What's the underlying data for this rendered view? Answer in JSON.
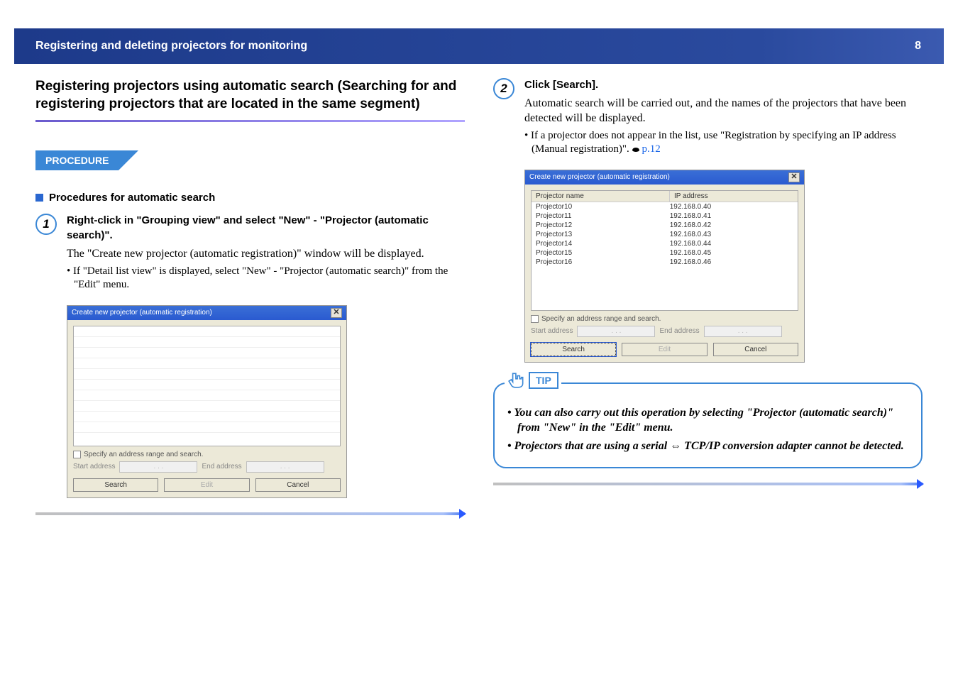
{
  "header": {
    "title": "Registering and deleting projectors for monitoring",
    "page_number": "8"
  },
  "left": {
    "heading": "Registering projectors using automatic search (Searching for and registering projectors that are located in the same segment)",
    "procedure_label": "PROCEDURE",
    "sub_heading": "Procedures for automatic search",
    "step1": {
      "num": "1",
      "title": "Right-click in \"Grouping view\" and select \"New\" - \"Projector (automatic search)\".",
      "text": "The \"Create new projector (automatic registration)\" window will be displayed.",
      "bullet": "• If \"Detail list view\" is displayed, select \"New\" - \"Projector (automatic search)\" from the \"Edit\" menu."
    },
    "dialog": {
      "title": "Create new projector (automatic registration)",
      "checkbox_label": "Specify an address range and search.",
      "start_label": "Start address",
      "end_label": "End address",
      "addr_placeholder": ".     .     .",
      "search_btn": "Search",
      "edit_btn": "Edit",
      "cancel_btn": "Cancel"
    }
  },
  "right": {
    "step2": {
      "num": "2",
      "title": "Click [Search].",
      "text": "Automatic search will be carried out, and the names of the projectors that have been detected will be displayed.",
      "bullet_prefix": "• If a projector does not appear in the list, use \"Registration by specifying an IP address (Manual registration)\". ",
      "page_link": "p.12"
    },
    "dialog": {
      "title": "Create new projector (automatic registration)",
      "col_name": "Projector name",
      "col_ip": "IP address",
      "rows": [
        {
          "name": "Projector10",
          "ip": "192.168.0.40"
        },
        {
          "name": "Projector11",
          "ip": "192.168.0.41"
        },
        {
          "name": "Projector12",
          "ip": "192.168.0.42"
        },
        {
          "name": "Projector13",
          "ip": "192.168.0.43"
        },
        {
          "name": "Projector14",
          "ip": "192.168.0.44"
        },
        {
          "name": "Projector15",
          "ip": "192.168.0.45"
        },
        {
          "name": "Projector16",
          "ip": "192.168.0.46"
        }
      ],
      "checkbox_label": "Specify an address range and search.",
      "start_label": "Start address",
      "end_label": "End address",
      "addr_placeholder": ".     .     .",
      "search_btn": "Search",
      "edit_btn": "Edit",
      "cancel_btn": "Cancel"
    },
    "tip": {
      "label": "TIP",
      "item1": "• You can also carry out this operation by selecting \"Projector (automatic search)\" from \"New\" in the \"Edit\" menu.",
      "item2": "• Projectors that are using a serial ⇔ TCP/IP conversion adapter cannot be detected."
    }
  }
}
